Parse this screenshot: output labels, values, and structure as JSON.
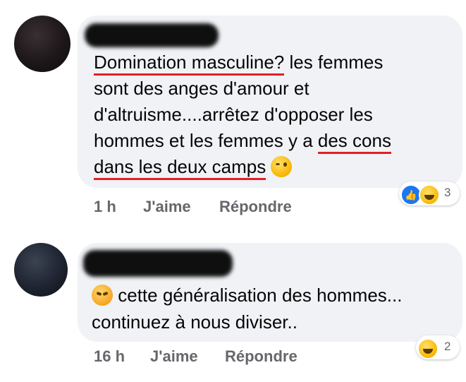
{
  "comments": [
    {
      "text_segments": {
        "l1_u": "Domination masculine?",
        "l1_rest": " les femmes",
        "l2": "sont des anges d'amour et",
        "l3": "d'altruisme....arrêtez d'opposer les",
        "l4_a": "hommes et les femmes y a ",
        "l4_u": "des cons",
        "l5_u": "dans les deux camps"
      },
      "emoji_icon": "wink-emoji-icon",
      "time": "1 h",
      "like_label": "J'aime",
      "reply_label": "Répondre",
      "reactions": {
        "icons": [
          "like-icon",
          "haha-icon"
        ],
        "count": "3"
      }
    },
    {
      "text_segments": {
        "l1": "cette généralisation des hommes...",
        "l2": "continuez à nous diviser.."
      },
      "emoji_icon": "angry-emoji-icon",
      "time": "16 h",
      "like_label": "J'aime",
      "reply_label": "Répondre",
      "reactions": {
        "icons": [
          "haha-icon"
        ],
        "count": "2"
      }
    }
  ],
  "colors": {
    "bubble": "#f0f2f5",
    "underline": "#e41e26",
    "meta": "#65676b",
    "like": "#1877f2"
  }
}
